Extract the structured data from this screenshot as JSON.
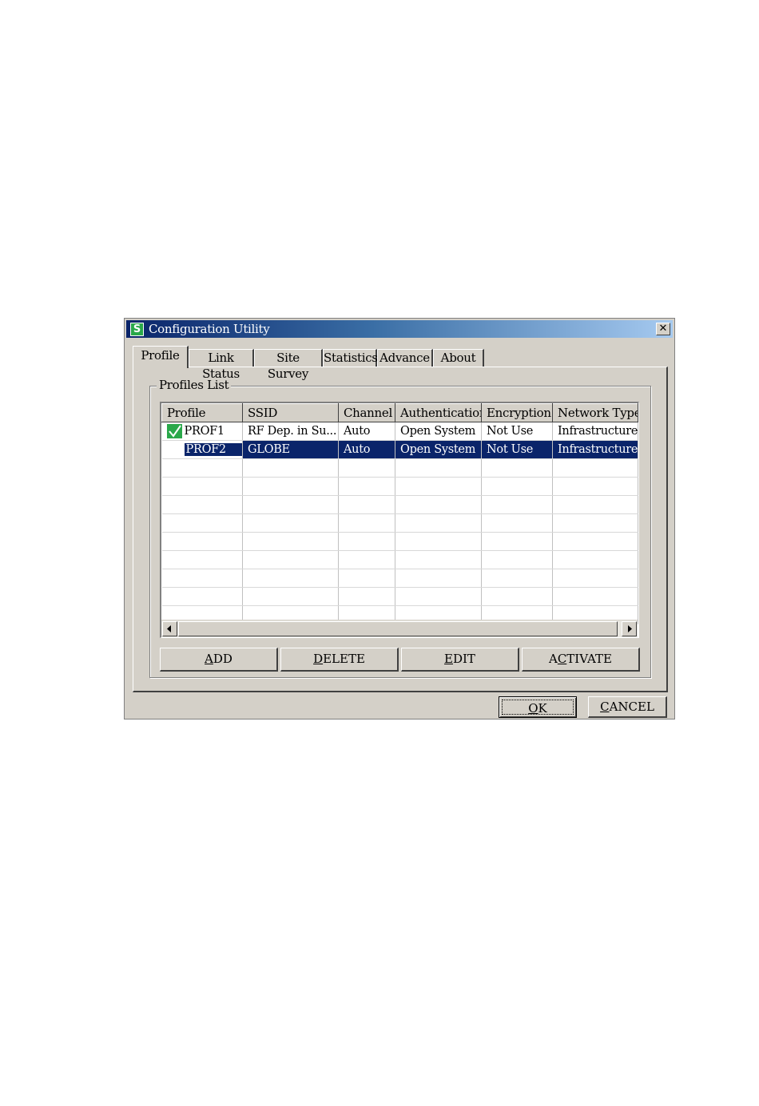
{
  "window": {
    "title": "Configuration Utility",
    "app_icon_glyph": "S",
    "close_glyph": "✕"
  },
  "tabs": [
    {
      "label": "Profile",
      "active": true
    },
    {
      "label": "Link Status",
      "active": false
    },
    {
      "label": "Site Survey",
      "active": false
    },
    {
      "label": "Statistics",
      "active": false
    },
    {
      "label": "Advance",
      "active": false
    },
    {
      "label": "About",
      "active": false
    }
  ],
  "profiles_list": {
    "group_label": "Profiles List",
    "columns": [
      "Profile",
      "SSID",
      "Channel",
      "Authentication",
      "Encryption",
      "Network Type"
    ],
    "rows": [
      {
        "profile": "PROF1",
        "ssid": "RF Dep. in Su...",
        "channel": "Auto",
        "authentication": "Open System",
        "encryption": "Not Use",
        "network_type": "Infrastructure",
        "active_icon": "green-check-icon",
        "selected": false
      },
      {
        "profile": "PROF2",
        "ssid": "GLOBE",
        "channel": "Auto",
        "authentication": "Open System",
        "encryption": "Not Use",
        "network_type": "Infrastructure",
        "active_icon": "",
        "selected": true
      }
    ],
    "empty_rows": 9
  },
  "actions": {
    "add": {
      "pre": "",
      "key": "A",
      "post": "DD"
    },
    "delete": {
      "pre": "",
      "key": "D",
      "post": "ELETE"
    },
    "edit": {
      "pre": "",
      "key": "E",
      "post": "DIT"
    },
    "activate": {
      "pre": "A",
      "key": "C",
      "post": "TIVATE"
    }
  },
  "dialog_buttons": {
    "ok": {
      "pre": "",
      "key": "O",
      "post": "K"
    },
    "cancel": {
      "pre": "",
      "key": "C",
      "post": "ANCEL"
    }
  },
  "colors": {
    "selection": "#0a246a",
    "face": "#d4d0c8",
    "check": "#2aa84a"
  }
}
